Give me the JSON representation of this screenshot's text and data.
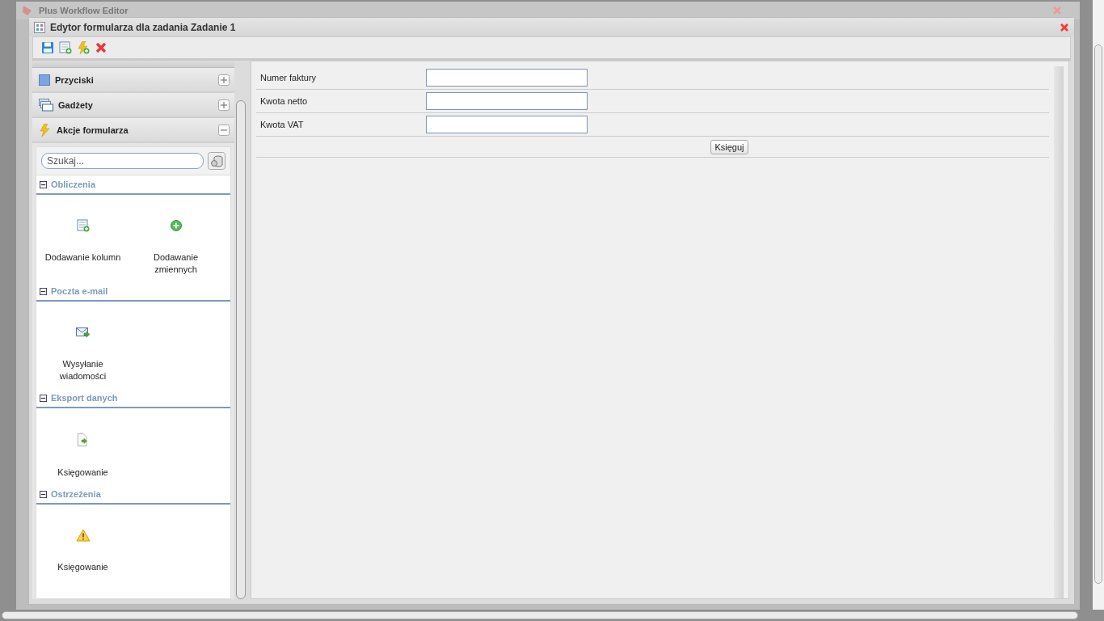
{
  "app": {
    "title": "Plus Workflow Editor"
  },
  "dialog": {
    "title": "Edytor formularza dla zadania Zadanie 1"
  },
  "accordion": [
    {
      "label": "Przyciski",
      "expanded": false
    },
    {
      "label": "Gadżety",
      "expanded": false
    },
    {
      "label": "Akcje formularza",
      "expanded": true
    }
  ],
  "search": {
    "placeholder": "Szukaj..."
  },
  "groups": [
    {
      "title": "Obliczenia",
      "expanded": true,
      "items": [
        "Dodawanie kolumn",
        "Dodawanie zmiennych"
      ]
    },
    {
      "title": "Poczta e-mail",
      "expanded": true,
      "items": [
        "Wysyłanie wiadomości"
      ]
    },
    {
      "title": "Eksport danych",
      "expanded": true,
      "items": [
        "Księgowanie"
      ]
    },
    {
      "title": "Ostrzeżenia",
      "expanded": true,
      "items": [
        "Księgowanie"
      ]
    }
  ],
  "form": {
    "fields": [
      {
        "label": "Numer faktury"
      },
      {
        "label": "Kwota netto"
      },
      {
        "label": "Kwota VAT"
      }
    ],
    "button": "Księguj"
  }
}
